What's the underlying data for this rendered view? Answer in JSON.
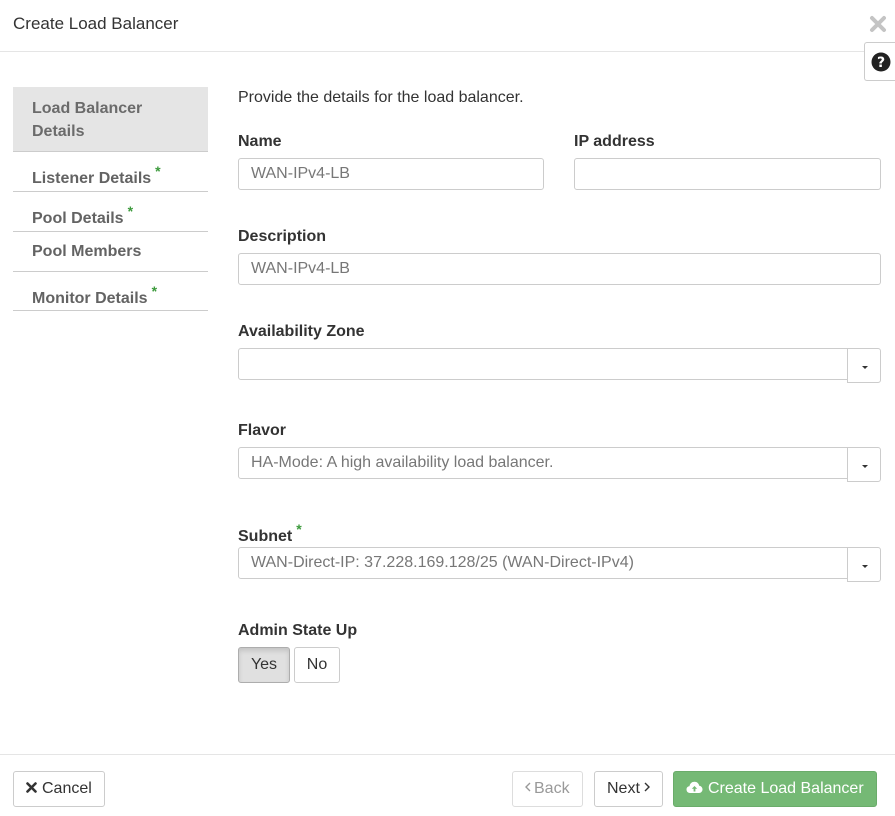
{
  "dialog": {
    "title": "Create Load Balancer"
  },
  "nav": {
    "items": [
      {
        "label": "Load Balancer Details",
        "required": false,
        "active": true
      },
      {
        "label": "Listener Details",
        "required": true,
        "active": false
      },
      {
        "label": "Pool Details",
        "required": true,
        "active": false
      },
      {
        "label": "Pool Members",
        "required": false,
        "active": false
      },
      {
        "label": "Monitor Details",
        "required": true,
        "active": false
      }
    ],
    "required_marker": "*"
  },
  "form": {
    "intro": "Provide the details for the load balancer.",
    "name": {
      "label": "Name",
      "value": "WAN-IPv4-LB"
    },
    "ip_address": {
      "label": "IP address",
      "value": ""
    },
    "description": {
      "label": "Description",
      "value": "WAN-IPv4-LB"
    },
    "availability_zone": {
      "label": "Availability Zone",
      "value": ""
    },
    "flavor": {
      "label": "Flavor",
      "value": "HA-Mode: A high availability load balancer."
    },
    "subnet": {
      "label": "Subnet",
      "required_marker": "*",
      "value": "WAN-Direct-IP: 37.228.169.128/25 (WAN-Direct-IPv4)"
    },
    "admin_state": {
      "label": "Admin State Up",
      "yes": "Yes",
      "no": "No",
      "selected": "Yes"
    }
  },
  "footer": {
    "cancel": "Cancel",
    "back": "Back",
    "next": "Next",
    "create": "Create Load Balancer"
  },
  "colors": {
    "required": "#3c9a3c",
    "primary_button": "#75b975",
    "active_nav_bg": "#e5e5e5"
  },
  "icons": [
    "close-icon",
    "help-icon",
    "cancel-x-icon",
    "chevron-left-icon",
    "chevron-right-icon",
    "cloud-upload-icon",
    "caret-down-icon"
  ]
}
